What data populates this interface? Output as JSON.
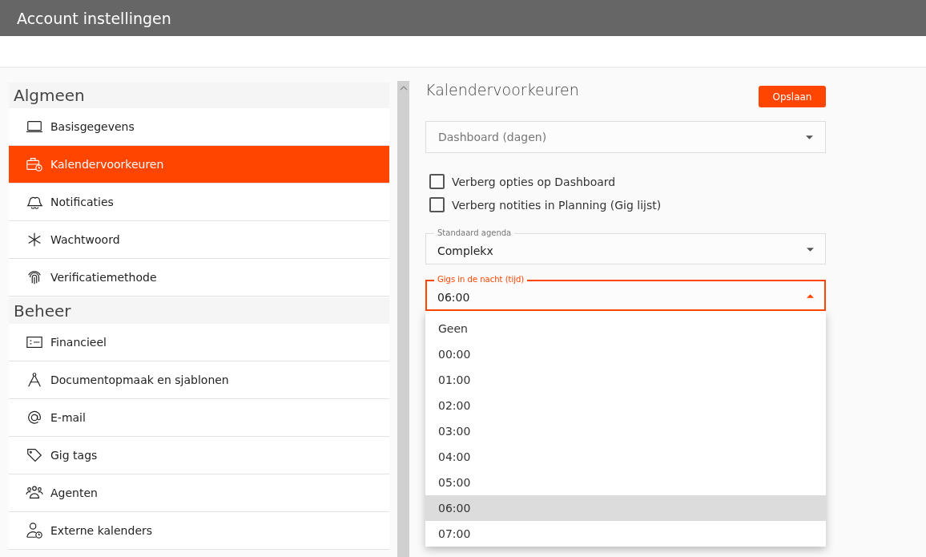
{
  "window": {
    "title": "Account instellingen"
  },
  "sidebar": {
    "sections": [
      {
        "title": "Algmeen",
        "items": [
          {
            "label": "Basisgegevens",
            "selected": false
          },
          {
            "label": "Kalendervoorkeuren",
            "selected": true
          },
          {
            "label": "Notificaties",
            "selected": false
          },
          {
            "label": "Wachtwoord",
            "selected": false
          },
          {
            "label": "Verificatiemethode",
            "selected": false
          }
        ]
      },
      {
        "title": "Beheer",
        "items": [
          {
            "label": "Financieel",
            "selected": false
          },
          {
            "label": "Documentopmaak en sjablonen",
            "selected": false
          },
          {
            "label": "E-mail",
            "selected": false
          },
          {
            "label": "Gig tags",
            "selected": false
          },
          {
            "label": "Agenten",
            "selected": false
          },
          {
            "label": "Externe kalenders",
            "selected": false
          }
        ]
      }
    ]
  },
  "panel": {
    "title": "Kalendervoorkeuren",
    "save_button": "Opslaan",
    "dashboard_select": {
      "placeholder": "Dashboard (dagen)"
    },
    "checkboxes": [
      {
        "label": "Verberg opties op Dashboard",
        "checked": false
      },
      {
        "label": "Verberg notities in Planning (Gig lijst)",
        "checked": false
      }
    ],
    "agenda_select": {
      "label": "Standaard agenda",
      "value": "Complekx"
    },
    "night_select": {
      "label": "Gigs in de nacht (tijd)",
      "value": "06:00",
      "expanded": true,
      "options": [
        {
          "label": "Geen",
          "selected": false
        },
        {
          "label": "00:00",
          "selected": false
        },
        {
          "label": "01:00",
          "selected": false
        },
        {
          "label": "02:00",
          "selected": false
        },
        {
          "label": "03:00",
          "selected": false
        },
        {
          "label": "04:00",
          "selected": false
        },
        {
          "label": "05:00",
          "selected": false
        },
        {
          "label": "06:00",
          "selected": true
        },
        {
          "label": "07:00",
          "selected": false
        }
      ]
    }
  }
}
